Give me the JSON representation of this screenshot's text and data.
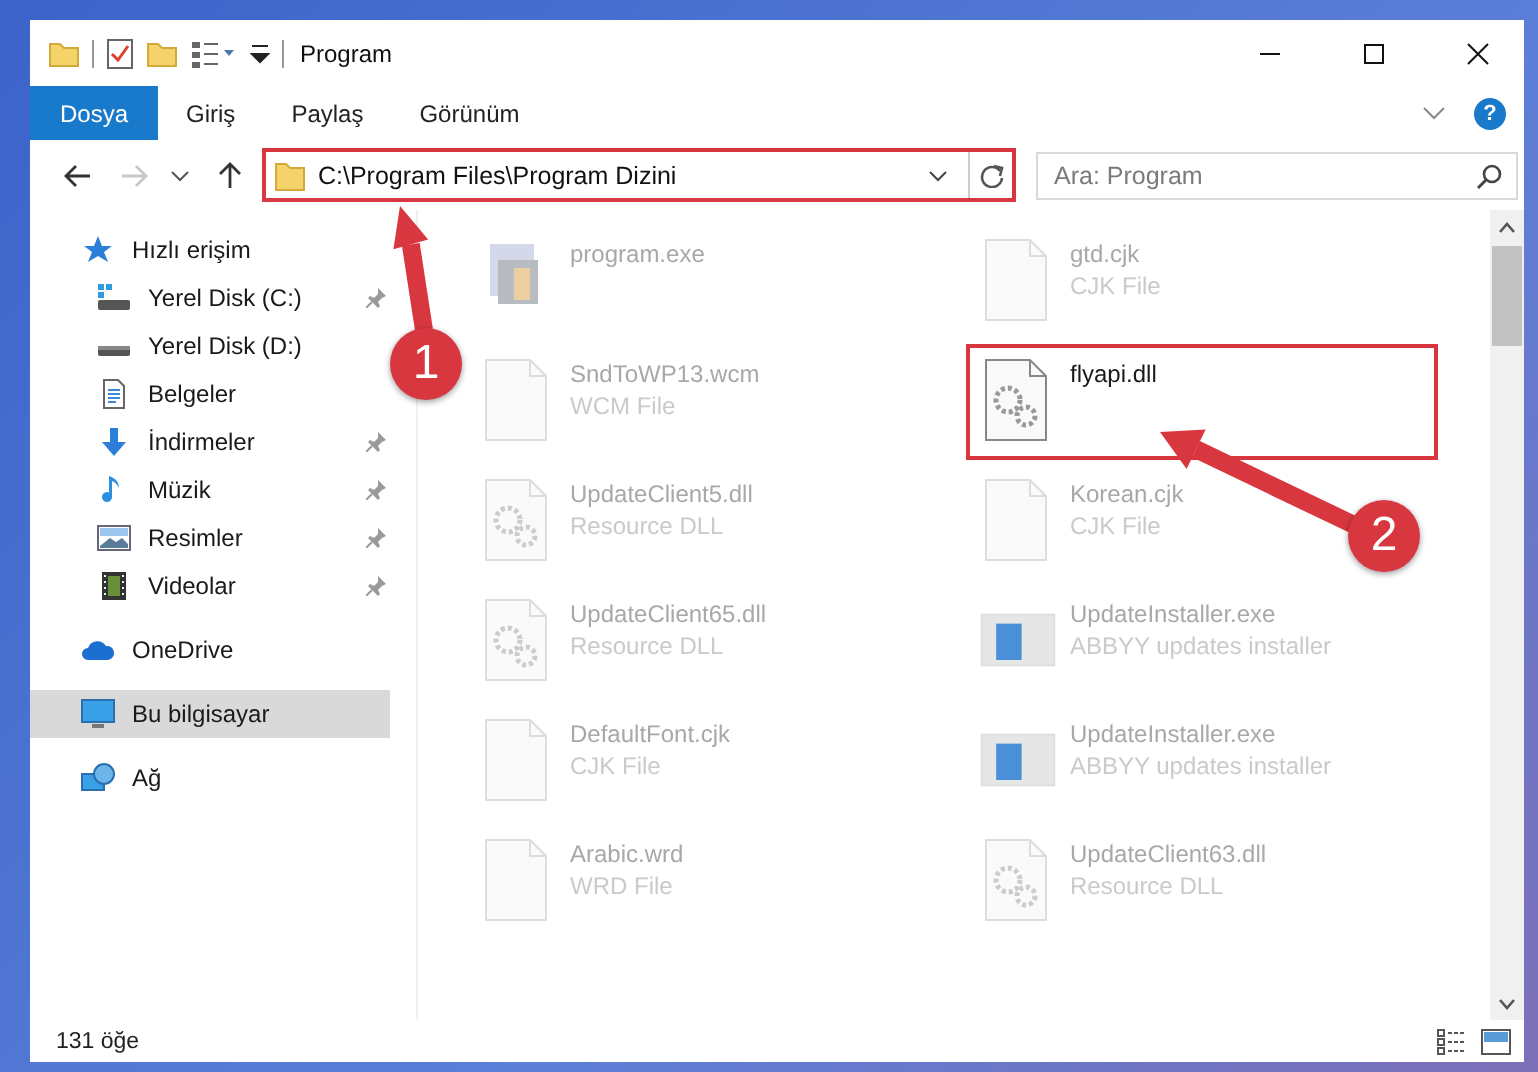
{
  "window": {
    "title": "Program"
  },
  "ribbon": {
    "tabs": [
      {
        "label": "Dosya",
        "selected": true
      },
      {
        "label": "Giriş",
        "selected": false
      },
      {
        "label": "Paylaş",
        "selected": false
      },
      {
        "label": "Görünüm",
        "selected": false
      }
    ],
    "help": "?"
  },
  "navigation": {
    "forward_disabled": true
  },
  "address_bar": {
    "path": "C:\\Program Files\\Program Dizini",
    "highlighted": true
  },
  "search": {
    "placeholder": "Ara: Program"
  },
  "sidebar": {
    "items": [
      {
        "label": "Hızlı erişim",
        "kind": "star",
        "selected": false,
        "children": [
          {
            "label": "Yerel Disk (C:)",
            "kind": "drive-c",
            "pinned": true,
            "selected": false
          },
          {
            "label": "Yerel Disk (D:)",
            "kind": "drive",
            "pinned": false,
            "selected": false
          },
          {
            "label": "Belgeler",
            "kind": "document",
            "pinned": false,
            "selected": false
          },
          {
            "label": "İndirmeler",
            "kind": "download",
            "pinned": true,
            "selected": false
          },
          {
            "label": "Müzik",
            "kind": "music",
            "pinned": true,
            "selected": false
          },
          {
            "label": "Resimler",
            "kind": "picture",
            "pinned": true,
            "selected": false
          },
          {
            "label": "Videolar",
            "kind": "video",
            "pinned": true,
            "selected": false
          }
        ]
      },
      {
        "label": "OneDrive",
        "kind": "cloud",
        "selected": false
      },
      {
        "label": "Bu bilgisayar",
        "kind": "computer",
        "selected": true
      },
      {
        "label": "Ağ",
        "kind": "network",
        "selected": false
      }
    ]
  },
  "files": [
    {
      "name": "program.exe",
      "kind": "app",
      "highlighted": false
    },
    {
      "name": "gtd.cjk",
      "type": "CJK File",
      "kind": "file",
      "highlighted": false
    },
    {
      "name": "SndToWP13.wcm",
      "type": "WCM File",
      "kind": "file",
      "highlighted": false
    },
    {
      "name": "flyapi.dll",
      "kind": "dll",
      "highlighted": true
    },
    {
      "name": "UpdateClient5.dll",
      "type": "Resource DLL",
      "kind": "dll",
      "highlighted": false
    },
    {
      "name": "Korean.cjk",
      "type": "CJK File",
      "kind": "file",
      "highlighted": false
    },
    {
      "name": "UpdateClient65.dll",
      "type": "Resource DLL",
      "kind": "dll",
      "highlighted": false
    },
    {
      "name": "UpdateInstaller.exe",
      "type": "ABBYY updates installer",
      "kind": "installer",
      "highlighted": false
    },
    {
      "name": "DefaultFont.cjk",
      "type": "CJK File",
      "kind": "file",
      "highlighted": false
    },
    {
      "name": "UpdateInstaller.exe",
      "type": "ABBYY updates installer",
      "kind": "installer",
      "highlighted": false
    },
    {
      "name": "Arabic.wrd",
      "type": "WRD File",
      "kind": "file",
      "highlighted": false
    },
    {
      "name": "UpdateClient63.dll",
      "type": "Resource DLL",
      "kind": "dll",
      "highlighted": false
    }
  ],
  "annotations": [
    {
      "number": "1"
    },
    {
      "number": "2"
    }
  ],
  "status_bar": {
    "item_count": "131 öğe"
  }
}
